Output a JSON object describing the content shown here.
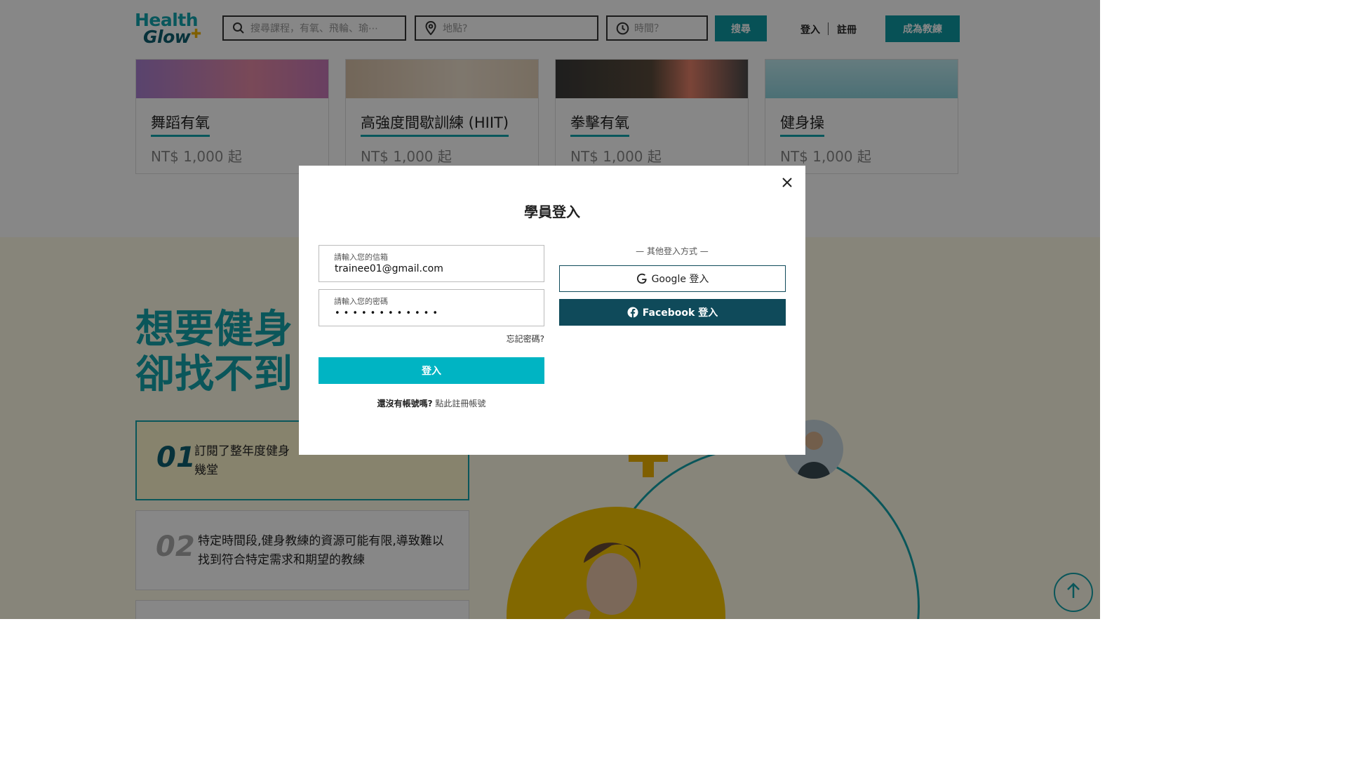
{
  "header": {
    "logo_line1": "Health",
    "logo_line2": "Glow",
    "search_placeholder": "搜尋課程，有氧、飛輪、瑜⋯",
    "location_placeholder": "地點?",
    "time_placeholder": "時間？",
    "search_button": "搜尋",
    "login_link": "登入",
    "register_link": "註冊",
    "become_coach_button": "成為教練"
  },
  "courses": [
    {
      "title": "舞蹈有氧",
      "price": "NT$ 1,000 起"
    },
    {
      "title": "高強度間歇訓練 (HIIT)",
      "price": "NT$ 1,000 起"
    },
    {
      "title": "拳擊有氧",
      "price": "NT$ 1,000 起"
    },
    {
      "title": "健身操",
      "price": "NT$ 1,000 起"
    }
  ],
  "pain_section": {
    "headline_line1": "想要健身",
    "headline_line2": "卻找不到",
    "points": [
      {
        "num": "01",
        "text": "訂閱了整年度健身"
      },
      {
        "num": "01",
        "text_line2": "幾堂"
      },
      {
        "num": "02",
        "text": "特定時間段,健身教練的資源可能有限,導致難以找到符合特定需求和期望的教練"
      }
    ]
  },
  "modal": {
    "title": "學員登入",
    "email_label": "請輸入您的信箱",
    "email_value": "trainee01@gmail.com",
    "password_label": "請輸入您的密碼",
    "password_mask": "••••••••••••",
    "forgot_password": "忘記密碼?",
    "login_button": "登入",
    "no_account_question": "還沒有帳號嗎?",
    "register_link": "點此註冊帳號",
    "other_methods": "— 其他登入方式 —",
    "google_button": "Google 登入",
    "facebook_button": "Facebook 登入"
  },
  "colors": {
    "brand_teal": "#12a5ae",
    "brand_dark": "#0f4a5a",
    "login_cyan": "#00b4c3",
    "accent_yellow": "#f5c400"
  },
  "icons": [
    "search-icon",
    "location-icon",
    "clock-icon",
    "close-icon",
    "google-icon",
    "facebook-icon",
    "arrow-up-icon"
  ]
}
